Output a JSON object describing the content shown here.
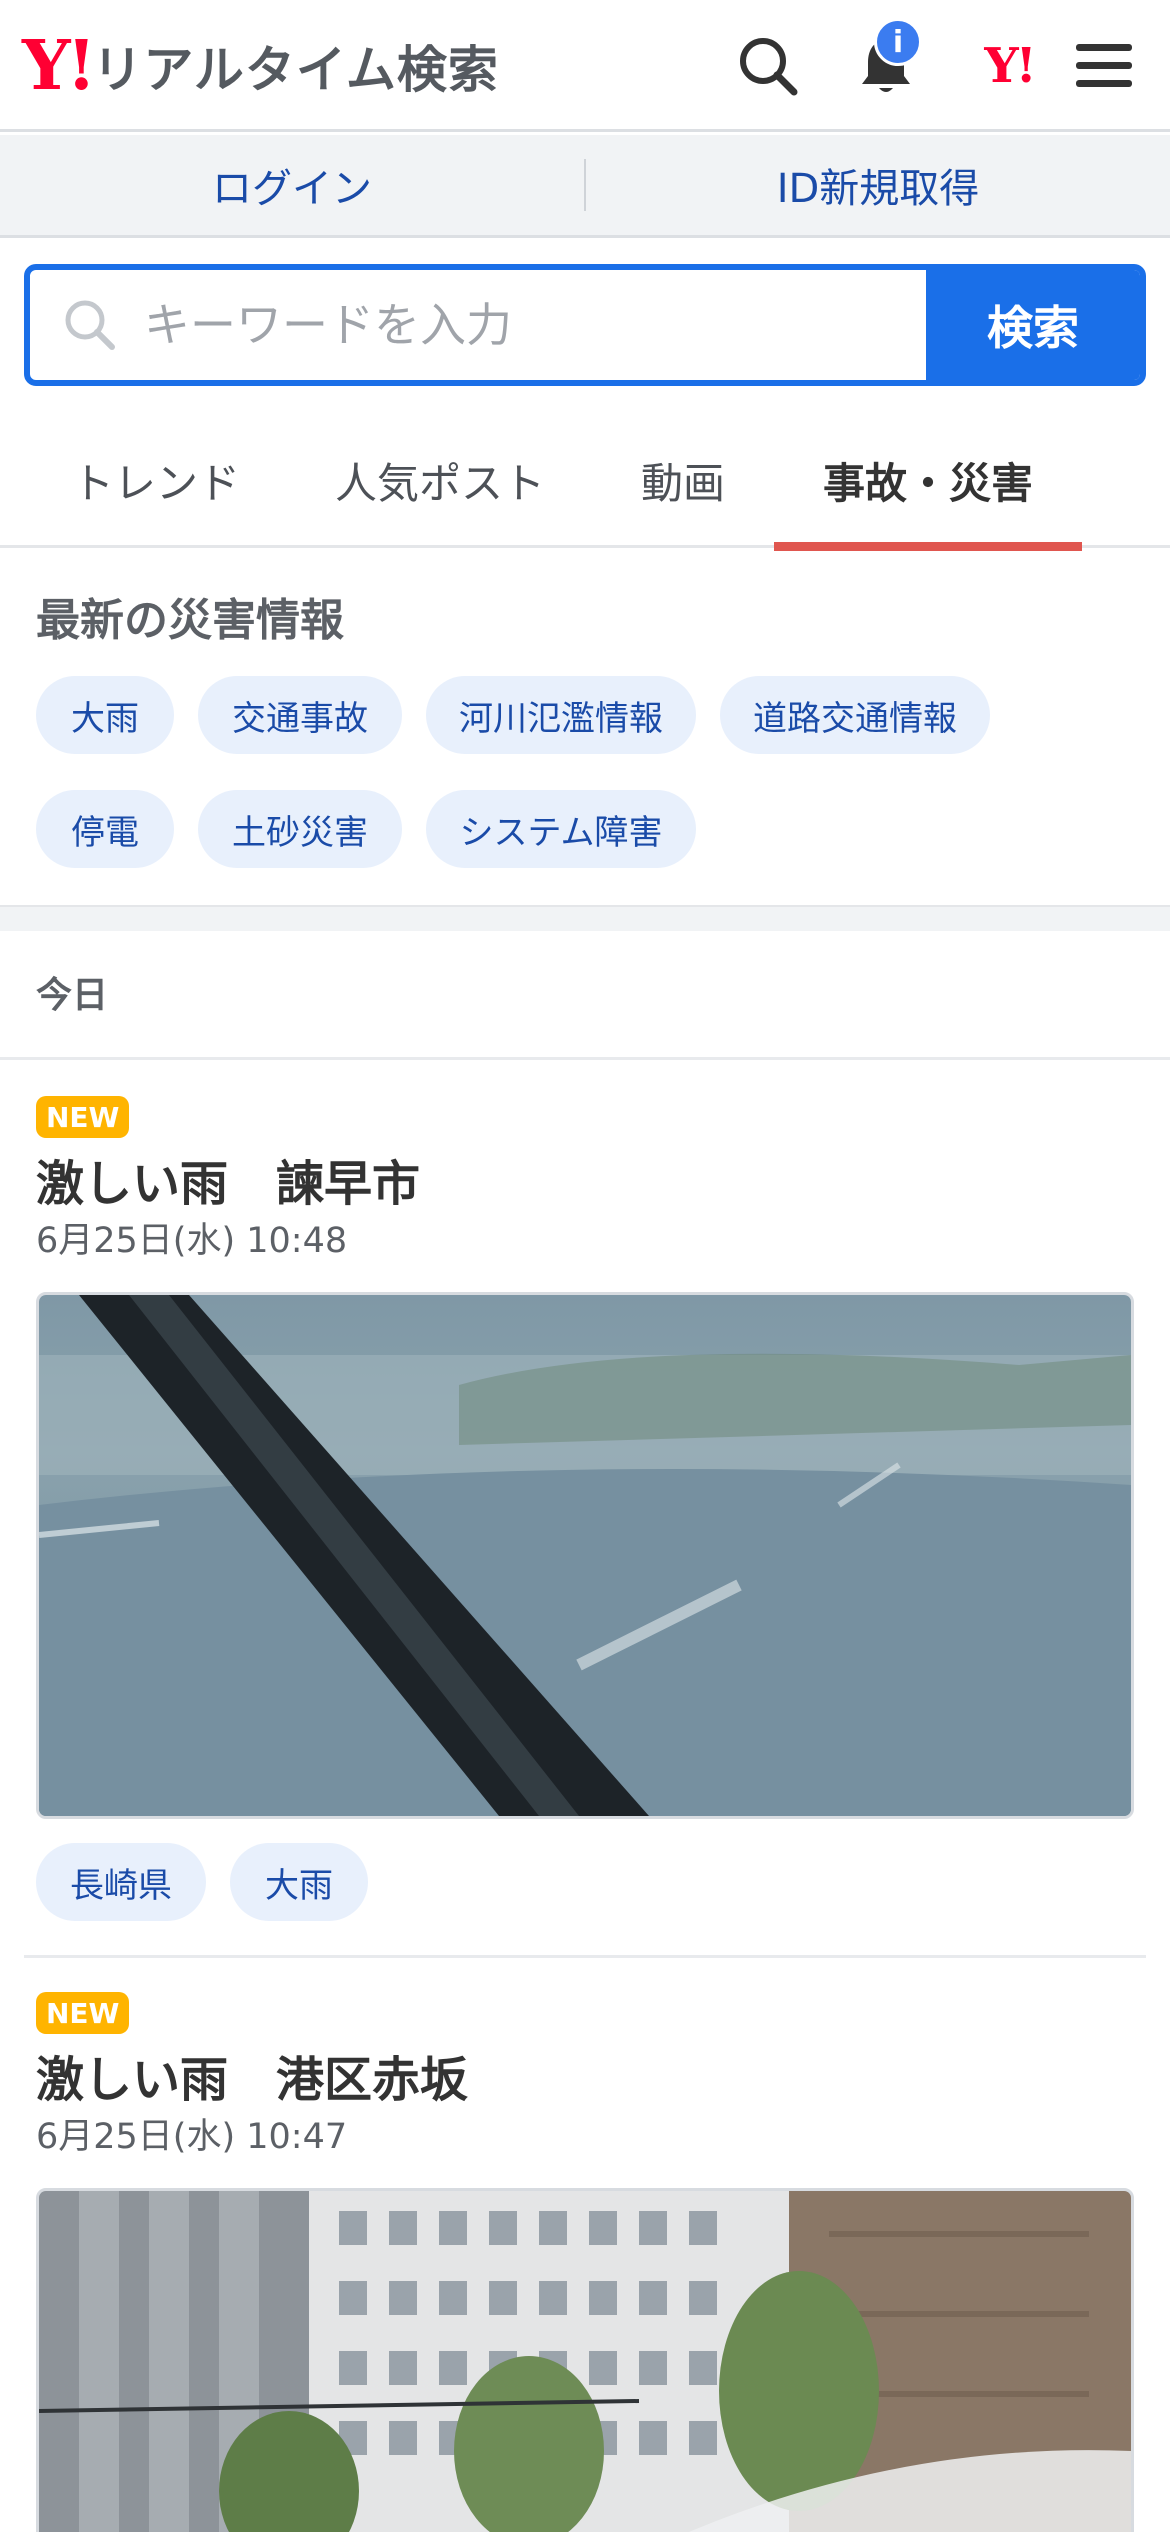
{
  "header": {
    "logo_mark": "Y!",
    "logo_text": "リアルタイム検索",
    "notification_badge": "i",
    "corner_logo": "Y!"
  },
  "auth": {
    "login_label": "ログイン",
    "signup_label": "ID新規取得"
  },
  "search": {
    "placeholder": "キーワードを入力",
    "value": "",
    "button_label": "検索"
  },
  "tabs": [
    {
      "label": "トレンド",
      "active": false
    },
    {
      "label": "人気ポスト",
      "active": false
    },
    {
      "label": "動画",
      "active": false
    },
    {
      "label": "事故・災害",
      "active": true
    }
  ],
  "disaster": {
    "title": "最新の災害情報",
    "chips": [
      "大雨",
      "交通事故",
      "河川氾濫情報",
      "道路交通情報",
      "停電",
      "土砂災害",
      "システム障害"
    ]
  },
  "feed": {
    "day_label": "今日",
    "posts": [
      {
        "badge": "NEW",
        "title": "激しい雨　諫早市",
        "time": "6月25日(水) 10:48",
        "tags": [
          "長崎県",
          "大雨"
        ]
      },
      {
        "badge": "NEW",
        "title": "激しい雨　港区赤坂",
        "time": "6月25日(水) 10:47",
        "tags": []
      }
    ]
  },
  "colors": {
    "brand_red": "#ff0033",
    "primary_blue": "#1a6fe8",
    "active_tab_underline": "#e0564f",
    "new_badge": "#ffb400",
    "chip_bg": "#e8f0fc"
  },
  "icons": {
    "search": "search-icon",
    "bell": "bell-icon",
    "menu": "hamburger-menu-icon"
  }
}
